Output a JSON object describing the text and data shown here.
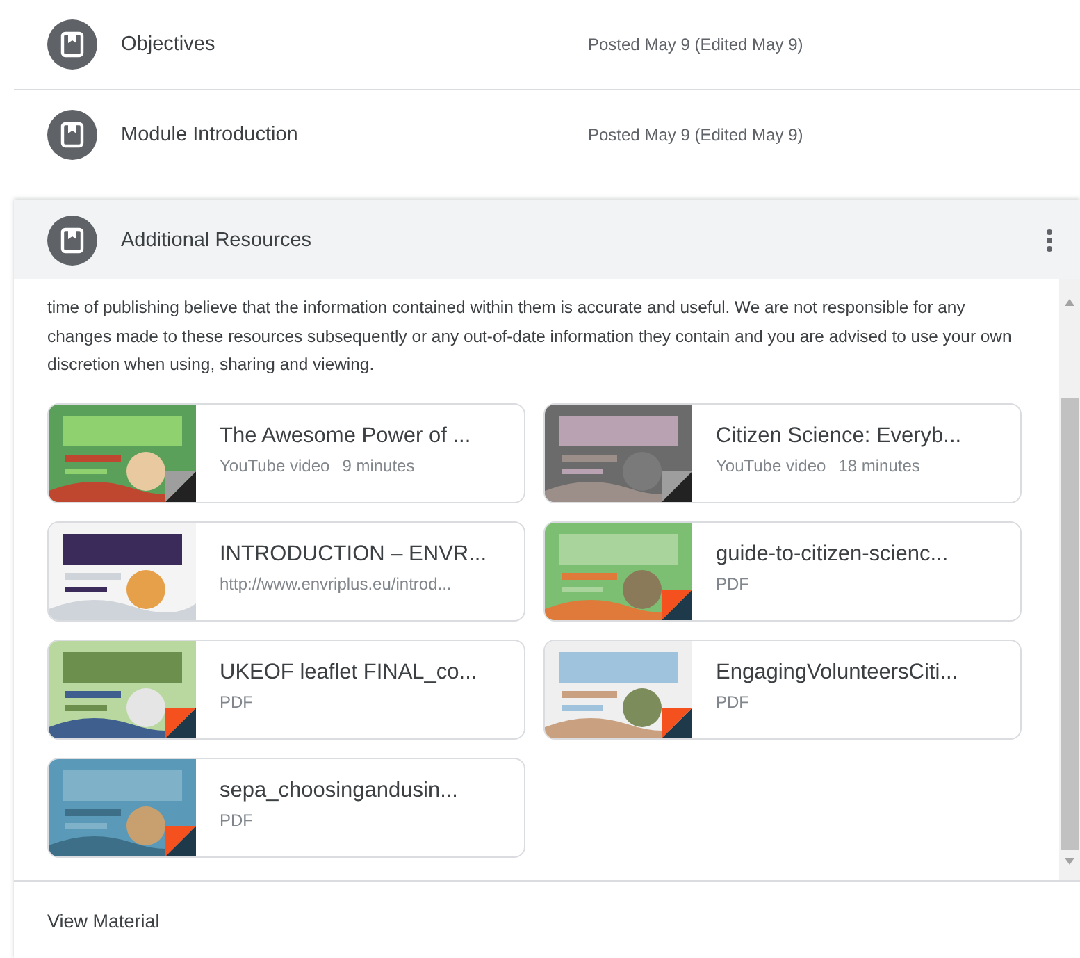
{
  "posts": [
    {
      "title": "Objectives",
      "meta": "Posted May 9 (Edited May 9)"
    },
    {
      "title": "Module Introduction",
      "meta": "Posted May 9 (Edited May 9)"
    }
  ],
  "expanded": {
    "title": "Additional Resources",
    "description": "time of publishing believe that the information contained within them is accurate and useful. We are not responsible for any changes made to these resources subsequently or any out-of-date information they contain and you are advised to use your own discretion when using, sharing and viewing.",
    "attachments": [
      {
        "kind": "video",
        "title": "The Awesome Power of ...",
        "source": "YouTube video",
        "duration": "9 minutes"
      },
      {
        "kind": "video",
        "title": "Citizen Science: Everyb...",
        "source": "YouTube video",
        "duration": "18 minutes"
      },
      {
        "kind": "link",
        "title": "INTRODUCTION – ENVR...",
        "source": "http://www.envriplus.eu/introd..."
      },
      {
        "kind": "pdf",
        "title": "guide-to-citizen-scienc...",
        "source": "PDF"
      },
      {
        "kind": "pdf",
        "title": "UKEOF leaflet FINAL_co...",
        "source": "PDF"
      },
      {
        "kind": "pdf",
        "title": "EngagingVolunteersCiti...",
        "source": "PDF"
      },
      {
        "kind": "pdf",
        "title": "sepa_choosingandusin...",
        "source": "PDF"
      }
    ],
    "footer_link": "View Material"
  }
}
